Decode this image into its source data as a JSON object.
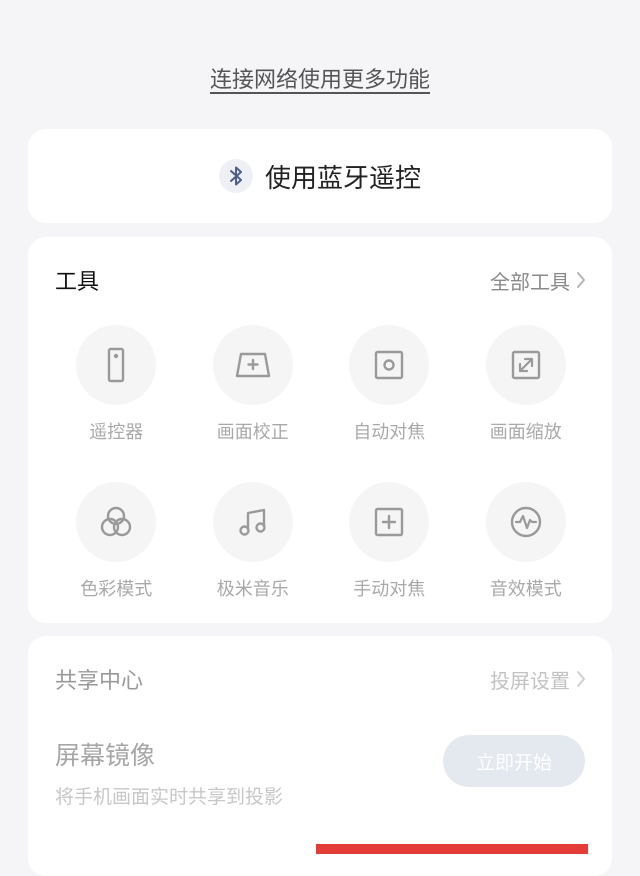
{
  "connect_link": "连接网络使用更多功能",
  "bluetooth": {
    "icon": "bluetooth-icon",
    "label": "使用蓝牙遥控"
  },
  "tools": {
    "title": "工具",
    "all_label": "全部工具",
    "items": [
      {
        "label": "遥控器",
        "icon": "remote-icon"
      },
      {
        "label": "画面校正",
        "icon": "keystone-icon"
      },
      {
        "label": "自动对焦",
        "icon": "autofocus-icon"
      },
      {
        "label": "画面缩放",
        "icon": "zoom-icon"
      },
      {
        "label": "色彩模式",
        "icon": "color-mode-icon"
      },
      {
        "label": "极米音乐",
        "icon": "music-icon"
      },
      {
        "label": "手动对焦",
        "icon": "manual-focus-icon"
      },
      {
        "label": "音效模式",
        "icon": "sound-effect-icon"
      }
    ]
  },
  "share": {
    "title": "共享中心",
    "settings_label": "投屏设置",
    "mirror_title": "屏幕镜像",
    "mirror_desc": "将手机画面实时共享到投影",
    "start_label": "立即开始"
  },
  "colors": {
    "bluetooth": "#4a5f8c",
    "bottom_bar": "#e33b36",
    "icon_stroke": "#9a9a9a"
  }
}
